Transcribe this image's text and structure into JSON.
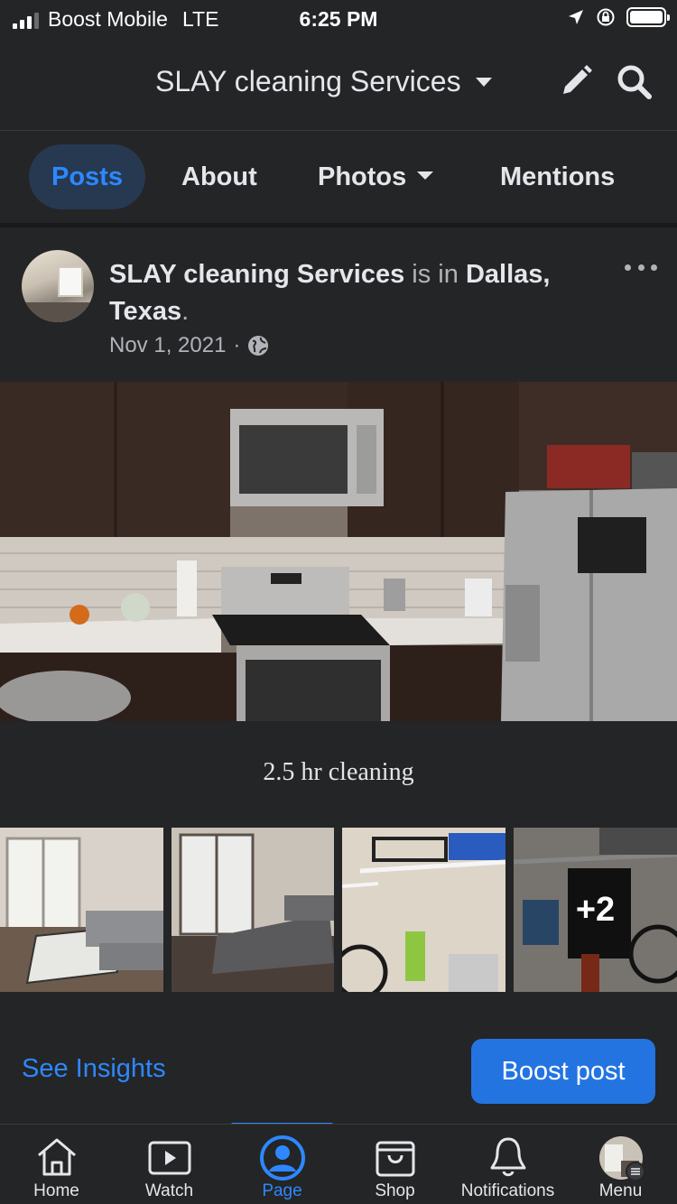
{
  "status_bar": {
    "carrier": "Boost Mobile",
    "network": "LTE",
    "time": "6:25 PM"
  },
  "header": {
    "title": "SLAY cleaning Services"
  },
  "tabs": [
    {
      "label": "Posts",
      "active": true
    },
    {
      "label": "About",
      "active": false
    },
    {
      "label": "Photos",
      "active": false
    },
    {
      "label": "Mentions",
      "active": false
    }
  ],
  "post": {
    "author": "SLAY cleaning Services",
    "connector": " is in ",
    "location": "Dallas, Texas",
    "end_punct": ".",
    "date": "Nov 1, 2021",
    "meta_sep": "·",
    "photo_caption": "2.5 hr cleaning",
    "more_photos": "+2"
  },
  "actions": {
    "insights_label": "See Insights",
    "boost_label": "Boost post"
  },
  "bottom_nav": [
    {
      "label": "Home",
      "icon": "home-icon",
      "active": false
    },
    {
      "label": "Watch",
      "icon": "watch-icon",
      "active": false
    },
    {
      "label": "Page",
      "icon": "page-icon",
      "active": true
    },
    {
      "label": "Shop",
      "icon": "shop-icon",
      "active": false
    },
    {
      "label": "Notifications",
      "icon": "bell-icon",
      "active": false
    },
    {
      "label": "Menu",
      "icon": "menu-avatar-icon",
      "active": false
    }
  ],
  "colors": {
    "background": "#242526",
    "accent": "#2d88ff",
    "button": "#2374e1",
    "active_tab_bg": "#263951",
    "secondary_text": "#b0b3b8"
  }
}
